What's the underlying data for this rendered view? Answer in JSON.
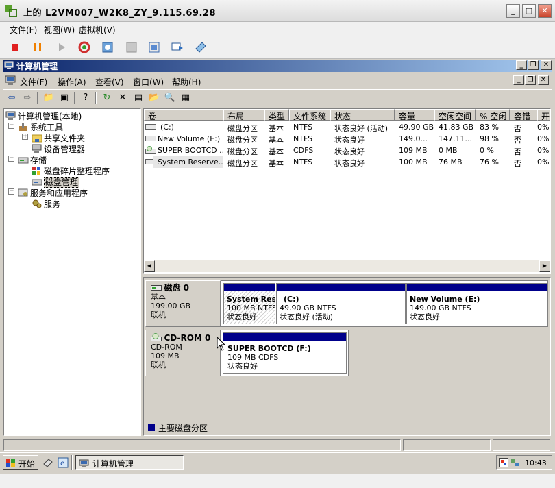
{
  "vm": {
    "title": "上的 L2VM007_W2K8_ZY_9.115.69.28",
    "menus": [
      "文件(F)",
      "视图(W)",
      "虚拟机(V)"
    ]
  },
  "mmc": {
    "title": "计算机管理",
    "menus": [
      "文件(F)",
      "操作(A)",
      "查看(V)",
      "窗口(W)",
      "帮助(H)"
    ]
  },
  "tree": {
    "root": "计算机管理(本地)",
    "system_tools": "系统工具",
    "shared_folders": "共享文件夹",
    "device_manager": "设备管理器",
    "storage": "存储",
    "defrag": "磁盘碎片整理程序",
    "disk_management": "磁盘管理",
    "services_apps": "服务和应用程序",
    "services": "服务"
  },
  "volumes": {
    "columns": [
      "卷",
      "布局",
      "类型",
      "文件系统",
      "状态",
      "容量",
      "空闲空间",
      "% 空闲",
      "容错",
      "开销"
    ],
    "rows": [
      {
        "vol": "(C:)",
        "layout": "磁盘分区",
        "type": "基本",
        "fs": "NTFS",
        "status": "状态良好 (活动)",
        "capacity": "49.90 GB",
        "free": "41.83 GB",
        "pct": "83 %",
        "ft": "否",
        "overhead": "0%"
      },
      {
        "vol": "New Volume (E:)",
        "layout": "磁盘分区",
        "type": "基本",
        "fs": "NTFS",
        "status": "状态良好",
        "capacity": "149.0...",
        "free": "147.11...",
        "pct": "98 %",
        "ft": "否",
        "overhead": "0%"
      },
      {
        "vol": "SUPER BOOTCD ...",
        "layout": "磁盘分区",
        "type": "基本",
        "fs": "CDFS",
        "status": "状态良好",
        "capacity": "109 MB",
        "free": "0 MB",
        "pct": "0 %",
        "ft": "否",
        "overhead": "0%"
      },
      {
        "vol": "System Reserve...",
        "layout": "磁盘分区",
        "type": "基本",
        "fs": "NTFS",
        "status": "状态良好",
        "capacity": "100 MB",
        "free": "76 MB",
        "pct": "76 %",
        "ft": "否",
        "overhead": "0%"
      }
    ]
  },
  "disks": {
    "disk0": {
      "name": "磁盘 0",
      "kind": "基本",
      "size": "199.00 GB",
      "state": "联机",
      "partitions": [
        {
          "name": "System Res",
          "detail": "100 MB NTFS",
          "status": "状态良好"
        },
        {
          "name": "(C:)",
          "detail": "49.90 GB NTFS",
          "status": "状态良好 (活动)"
        },
        {
          "name": "New Volume  (E:)",
          "detail": "149.00 GB NTFS",
          "status": "状态良好"
        }
      ]
    },
    "cdrom0": {
      "name": "CD-ROM 0",
      "kind": "CD-ROM",
      "size": "109 MB",
      "state": "联机",
      "partition": {
        "name": "SUPER BOOTCD  (F:)",
        "detail": "109 MB CDFS",
        "status": "状态良好"
      }
    },
    "legend": "主要磁盘分区"
  },
  "taskbar": {
    "start": "开始",
    "task": "计算机管理",
    "clock": "10:43"
  },
  "colors": {
    "primary_partition": "#00008b",
    "title_bar": "#0a246a"
  }
}
